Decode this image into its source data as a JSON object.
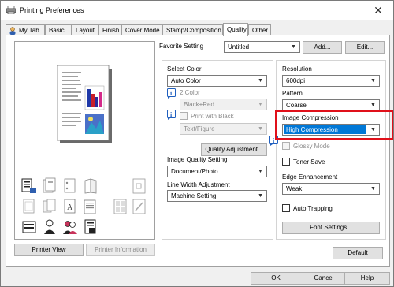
{
  "window": {
    "title": "Printing Preferences"
  },
  "tabs": [
    {
      "label": "My Tab"
    },
    {
      "label": "Basic"
    },
    {
      "label": "Layout"
    },
    {
      "label": "Finish"
    },
    {
      "label": "Cover Mode"
    },
    {
      "label": "Stamp/Composition"
    },
    {
      "label": "Quality"
    },
    {
      "label": "Other"
    }
  ],
  "favorite": {
    "label": "Favorite Setting",
    "value": "Untitled",
    "add": "Add...",
    "edit": "Edit..."
  },
  "preview_buttons": {
    "printer_view": "Printer View",
    "printer_information": "Printer Information"
  },
  "select_color": {
    "label": "Select Color",
    "value": "Auto Color"
  },
  "two_color": {
    "label": "2 Color",
    "value": "Black+Red"
  },
  "print_with_black": {
    "label": "Print with Black",
    "value": "Text/Figure"
  },
  "quality_adjustment": "Quality Adjustment...",
  "image_quality": {
    "label": "Image Quality Setting",
    "value": "Document/Photo"
  },
  "line_width": {
    "label": "Line Width Adjustment",
    "value": "Machine Setting"
  },
  "resolution": {
    "label": "Resolution",
    "value": "600dpi"
  },
  "pattern": {
    "label": "Pattern",
    "value": "Coarse"
  },
  "image_compression": {
    "label": "Image Compression",
    "value": "High Compression"
  },
  "glossy_mode": "Glossy Mode",
  "toner_save": "Toner Save",
  "edge_enhancement": {
    "label": "Edge Enhancement",
    "value": "Weak"
  },
  "auto_trapping": "Auto Trapping",
  "font_settings": "Font Settings...",
  "default": "Default",
  "ok": "OK",
  "cancel": "Cancel",
  "help": "Help",
  "colors": {
    "highlight_blue": "#0078d7",
    "callout_red": "#e0101a",
    "info_blue": "#1f5fbf"
  }
}
